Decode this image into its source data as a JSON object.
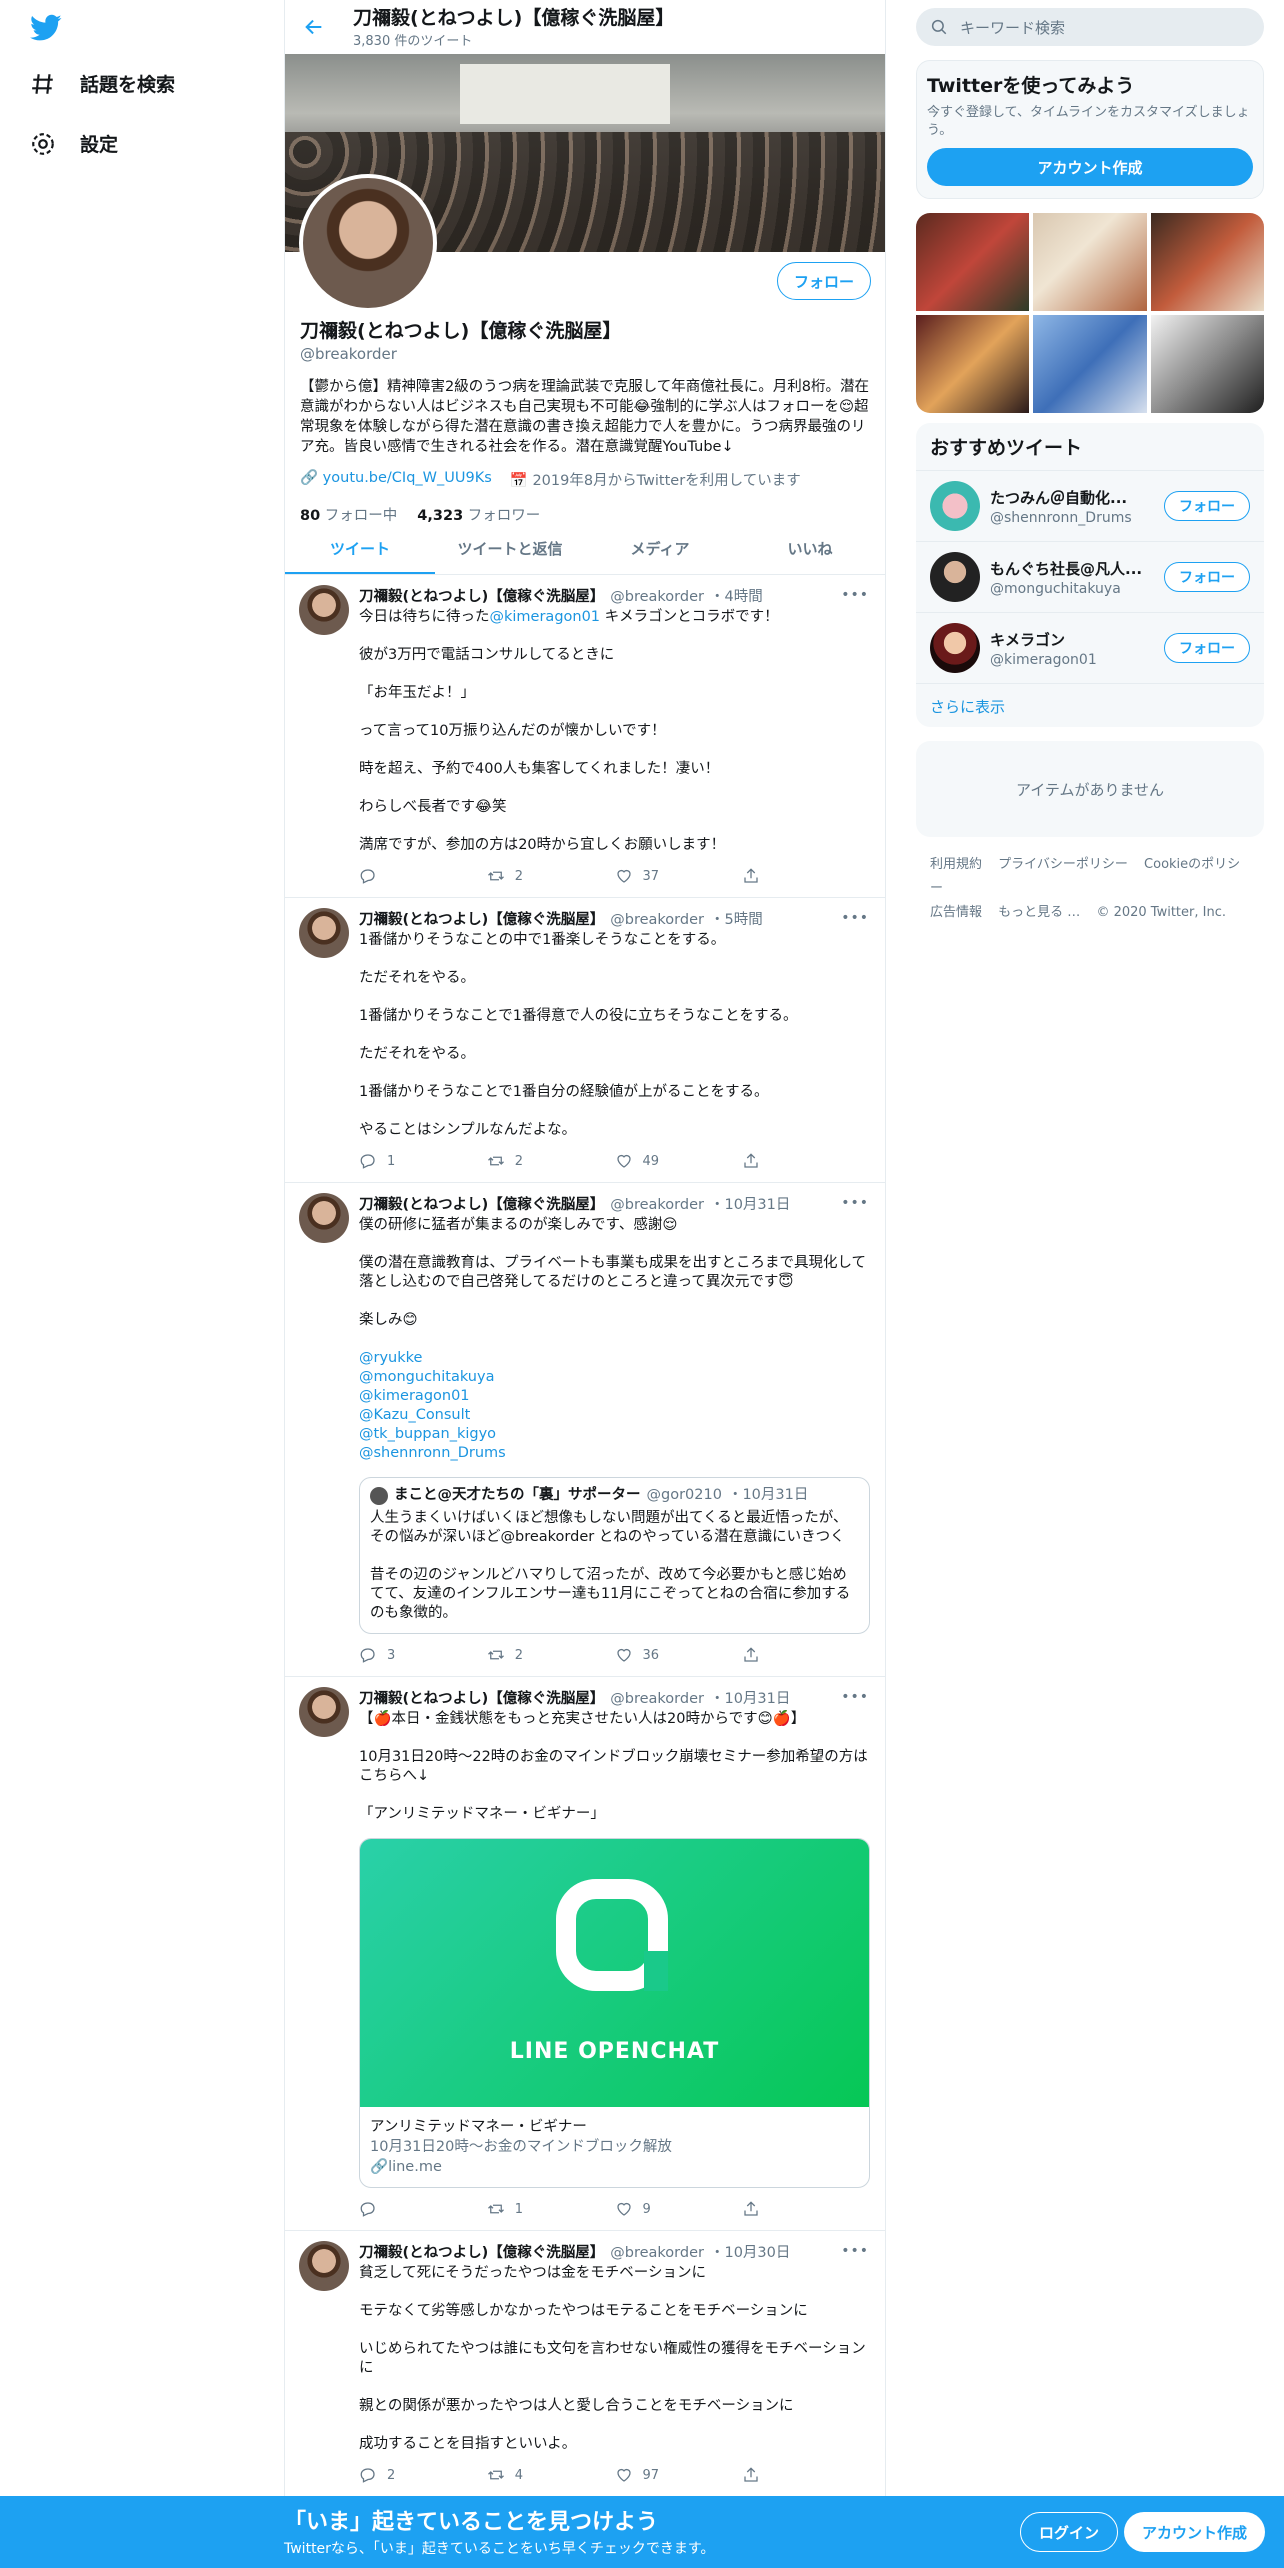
{
  "nav": {
    "explore_label": "話題を検索",
    "settings_label": "設定"
  },
  "header": {
    "name": "刀禰毅(とねつよし)【億稼ぐ洗脳屋】",
    "tweet_count": "3,830 件のツイート"
  },
  "profile": {
    "follow_label": "フォロー",
    "name": "刀禰毅(とねつよし)【億稼ぐ洗脳屋】",
    "handle": "@breakorder",
    "bio": "【鬱から億】精神障害2級のうつ病を理論武装で克服して年商億社長に。月利8桁。潜在意識がわからない人はビジネスも自己実現も不可能😂強制的に学ぶ人はフォローを😌超常現象を体験しながら得た潜在意識の書き換え超能力で人を豊かに。うつ病界最強のリア充。皆良い感情で生きれる社会を作る。潜在意識覚醒YouTube↓",
    "link": "youtu.be/CIq_W_UU9Ks",
    "joined": "2019年8月からTwitterを利用しています",
    "following_count": "80",
    "following_label": "フォロー中",
    "followers_count": "4,323",
    "followers_label": "フォロワー"
  },
  "tabs": [
    "ツイート",
    "ツイートと返信",
    "メディア",
    "いいね"
  ],
  "tweets": [
    {
      "name": "刀禰毅(とねつよし)【億稼ぐ洗脳屋】",
      "handle": "@breakorder",
      "time": "・4時間",
      "p1a": "今日は待ちに待った",
      "p1link": "@kimeragon01",
      "p1b": " キメラゴンとコラボです！",
      "p2": "彼が3万円で電話コンサルしてるときに",
      "p3": "「お年玉だよ！」",
      "p4": "って言って10万振り込んだのが懐かしいです！",
      "p5": "時を超え、予約で400人も集客してくれました！凄い！",
      "p6": "わらしべ長者です😂笑",
      "p7": "満席ですが、参加の方は20時から宜しくお願いします！",
      "replies": "",
      "retweets": "2",
      "likes": "37"
    },
    {
      "name": "刀禰毅(とねつよし)【億稼ぐ洗脳屋】",
      "handle": "@breakorder",
      "time": "・5時間",
      "p1": "1番儲かりそうなことの中で1番楽しそうなことをする。",
      "p2": "ただそれをやる。",
      "p3": "1番儲かりそうなことで1番得意で人の役に立ちそうなことをする。",
      "p4": "ただそれをやる。",
      "p5": "1番儲かりそうなことで1番自分の経験値が上がることをする。",
      "p6": "やることはシンプルなんだよな。",
      "replies": "1",
      "retweets": "2",
      "likes": "49"
    },
    {
      "name": "刀禰毅(とねつよし)【億稼ぐ洗脳屋】",
      "handle": "@breakorder",
      "time": "・10月31日",
      "p1": "僕の研修に猛者が集まるのが楽しみです、感謝😌",
      "p2": "僕の潜在意識教育は、プライベートも事業も成果を出すところまで具現化して落とし込むので自己啓発してるだけのところと違って異次元です😇",
      "p3": "楽しみ😊",
      "mentions": [
        "@ryukke",
        "@monguchitakuya",
        "@kimeragon01",
        "@Kazu_Consult",
        "@tk_buppan_kigyo",
        "@shennronn_Drums"
      ],
      "quote_name": "まこと@天才たちの「裏」サポーター",
      "quote_handle": "@gor0210",
      "quote_time": "・10月31日",
      "quote_p1": "人生うまくいけばいくほど想像もしない問題が出てくると最近悟ったが、その悩みが深いほど@breakorder とねのやっている潜在意識にいきつく",
      "quote_p2": "昔その辺のジャンルどハマりして沼ったが、改めて今必要かもと感じ始めてて、友達のインフルエンサー達も11月にこぞってとねの合宿に参加するのも象徴的。",
      "replies": "3",
      "retweets": "2",
      "likes": "36"
    },
    {
      "name": "刀禰毅(とねつよし)【億稼ぐ洗脳屋】",
      "handle": "@breakorder",
      "time": "・10月31日",
      "p1": "【🍎本日・金銭状態をもっと充実させたい人は20時からです😊🍎】",
      "p2": "10月31日20時〜22時のお金のマインドブロック崩壊セミナー参加希望の方はこちらへ↓",
      "p3": "「アンリミテッドマネー・ビギナー」",
      "card_logo": "LINE OPENCHAT",
      "card_title": "アンリミテッドマネー・ビギナー",
      "card_desc": "10月31日20時〜お金のマインドブロック解放",
      "card_domain": "line.me",
      "replies": "",
      "retweets": "1",
      "likes": "9"
    },
    {
      "name": "刀禰毅(とねつよし)【億稼ぐ洗脳屋】",
      "handle": "@breakorder",
      "time": "・10月30日",
      "p1": "貧乏して死にそうだったやつは金をモチベーションに",
      "p2": "モテなくて劣等感しかなかったやつはモテることをモチベーションに",
      "p3": "いじめられてたやつは誰にも文句を言わせない権威性の獲得をモチベーションに",
      "p4": "親との関係が悪かったやつは人と愛し合うことをモチベーションに",
      "p5": "成功することを目指すといいよ。",
      "replies": "2",
      "retweets": "4",
      "likes": "97"
    }
  ],
  "sidebar": {
    "search_placeholder": "キーワード検索",
    "try_title": "Twitterを使ってみよう",
    "try_desc": "今すぐ登録して、タイムラインをカスタマイズしましょう。",
    "create_account": "アカウント作成",
    "rec_title": "おすすめツイート",
    "recs": [
      {
        "name": "たつみん＠自動化...",
        "handle": "@shennronn_Drums",
        "follow": "フォロー"
      },
      {
        "name": "もんぐち社長@凡人...",
        "handle": "@monguchitakuya",
        "follow": "フォロー"
      },
      {
        "name": "キメラゴン",
        "handle": "@kimeragon01",
        "follow": "フォロー"
      }
    ],
    "show_more": "さらに表示",
    "no_items": "アイテムがありません",
    "footer": {
      "terms": "利用規約",
      "privacy": "プライバシーポリシー",
      "cookie": "Cookieのポリシー",
      "ads": "広告情報",
      "more": "もっと見る …",
      "copyright": "© 2020 Twitter, Inc."
    }
  },
  "bottombar": {
    "title": "「いま」起きていることを見つけよう",
    "subtitle": "Twitterなら、「いま」起きていることをいち早くチェックできます。",
    "login": "ログイン",
    "signup": "アカウント作成"
  },
  "colors": {
    "accent": "#1da1f2",
    "link": "#1b95e0",
    "line_green": "#06c755"
  }
}
